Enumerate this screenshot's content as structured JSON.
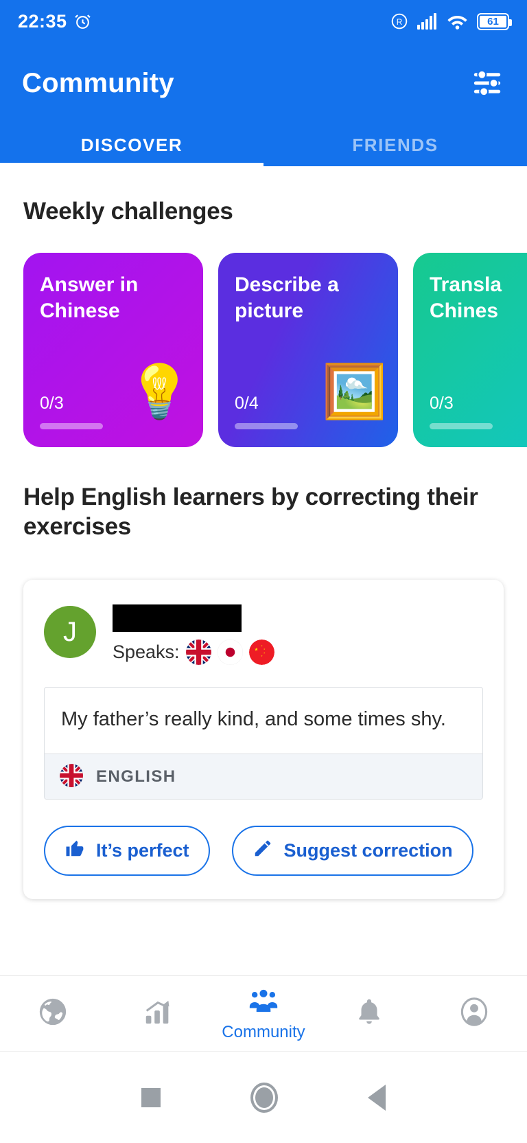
{
  "status_bar": {
    "time": "22:35",
    "alarm_icon": "alarm-icon",
    "registered_icon": "registered-icon",
    "signal_icon": "signal-icon",
    "wifi_icon": "wifi-icon",
    "battery_level": "61"
  },
  "app_bar": {
    "title": "Community",
    "filter_icon": "tune-filter-icon"
  },
  "tabs": [
    {
      "label": "DISCOVER",
      "active": true
    },
    {
      "label": "FRIENDS",
      "active": false
    }
  ],
  "weekly": {
    "section_title": "Weekly challenges",
    "cards": [
      {
        "title": "Answer in\nChinese",
        "count": "0/3",
        "emoji": "💡",
        "emoji_name": "lightbulb-question-icon",
        "color_from": "#a214f0",
        "color_to": "#b712e8"
      },
      {
        "title": "Describe a\npicture",
        "count": "0/4",
        "emoji": "🖼️",
        "emoji_name": "framed-picture-icon",
        "color_from": "#5b2ee0",
        "color_to": "#1f62e8"
      },
      {
        "title": "Transla\nChines",
        "count": "0/3",
        "emoji": "",
        "emoji_name": "none",
        "color_from": "#17c98f",
        "color_to": "#12c6c0"
      }
    ]
  },
  "help": {
    "heading": "Help English learners by correcting their exercises"
  },
  "exercise": {
    "avatar_initial": "J",
    "name_redacted": true,
    "speaks_label": "Speaks:",
    "speaks_flags": [
      "uk-flag-icon",
      "japan-flag-icon",
      "china-flag-icon"
    ],
    "text": "My father’s really kind, and some times shy.",
    "language_flag": "uk-flag-icon",
    "language_label": "ENGLISH",
    "perfect_button": "It’s perfect",
    "perfect_icon": "thumbs-up-icon",
    "correction_button": "Suggest correction",
    "correction_icon": "pencil-icon"
  },
  "bottom_nav": [
    {
      "icon": "globe-icon",
      "label": "",
      "active": false
    },
    {
      "icon": "stats-chart-icon",
      "label": "",
      "active": false
    },
    {
      "icon": "community-people-icon",
      "label": "Community",
      "active": true
    },
    {
      "icon": "bell-icon",
      "label": "",
      "active": false
    },
    {
      "icon": "profile-avatar-icon",
      "label": "",
      "active": false
    }
  ],
  "android_nav": {
    "recents_icon": "square-recents-icon",
    "home_icon": "circle-home-icon",
    "back_icon": "triangle-back-icon"
  },
  "colors": {
    "brand_blue": "#1472ec",
    "link_blue": "#1a73e8",
    "avatar_green": "#64a22e"
  }
}
